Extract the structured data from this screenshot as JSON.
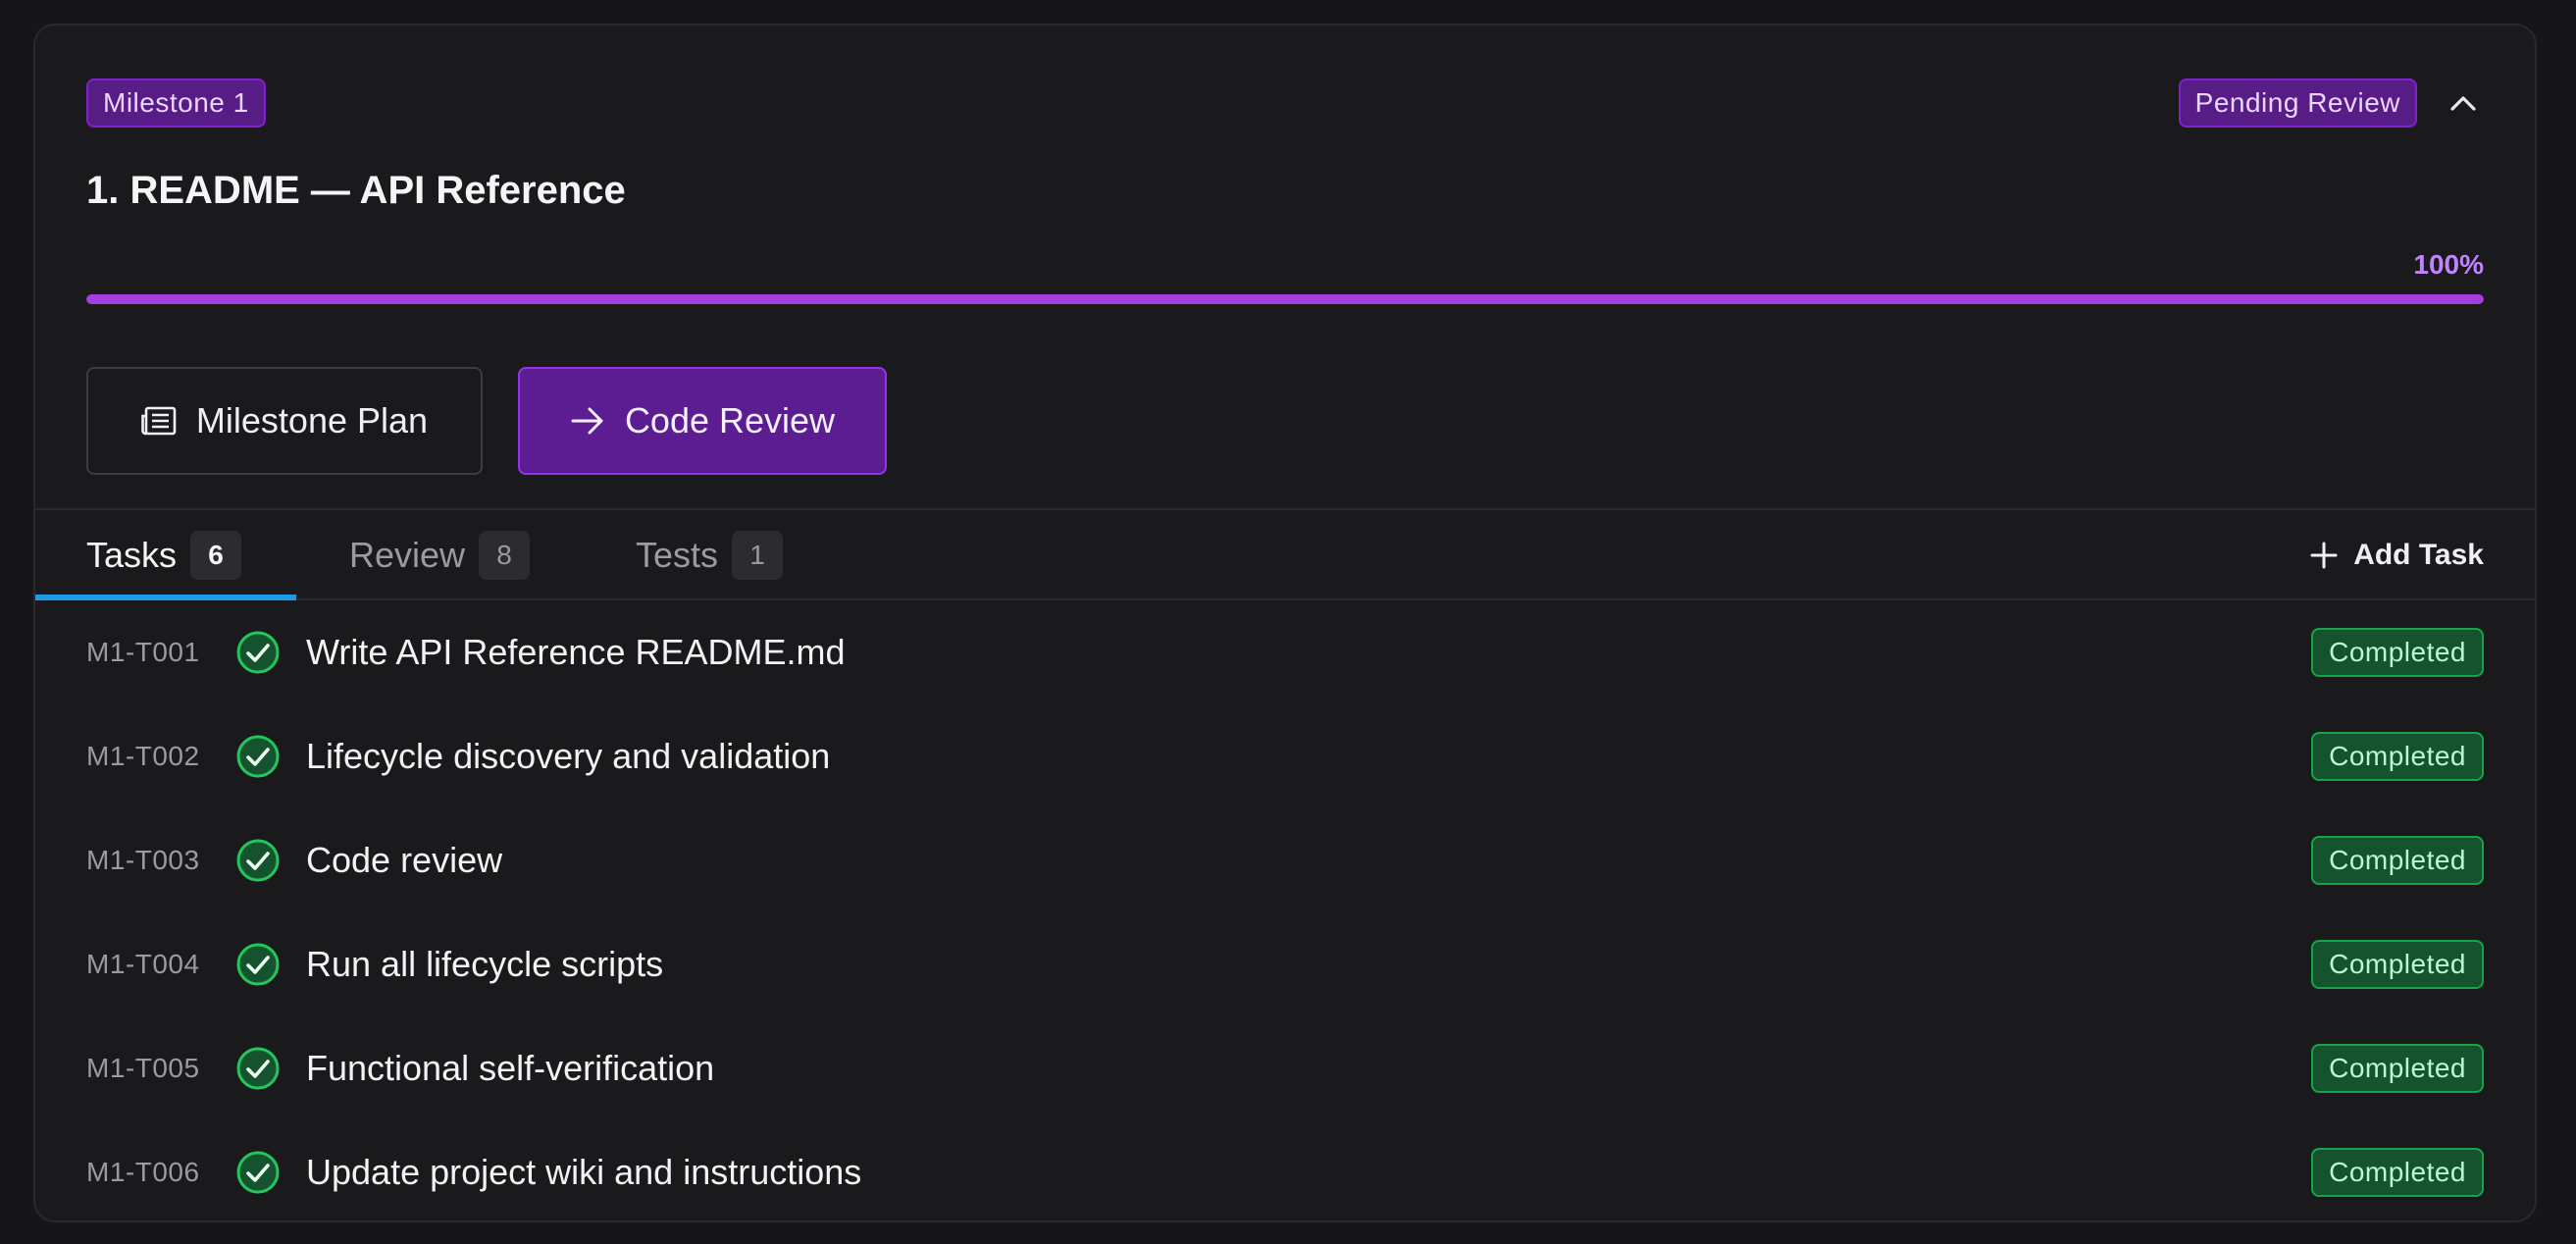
{
  "milestone": {
    "badge": "Milestone 1",
    "status": "Pending Review",
    "title": "1. README — API Reference",
    "progress_label": "100%",
    "progress_fraction": 1.0
  },
  "actions": {
    "plan_label": "Milestone Plan",
    "review_label": "Code Review"
  },
  "tabs": [
    {
      "label": "Tasks",
      "count": "6",
      "active": true
    },
    {
      "label": "Review",
      "count": "8",
      "active": false
    },
    {
      "label": "Tests",
      "count": "1",
      "active": false
    }
  ],
  "add_task_label": "Add Task",
  "tasks": [
    {
      "id": "M1-T001",
      "name": "Write API Reference README.md",
      "status": "Completed"
    },
    {
      "id": "M1-T002",
      "name": "Lifecycle discovery and validation",
      "status": "Completed"
    },
    {
      "id": "M1-T003",
      "name": "Code review",
      "status": "Completed"
    },
    {
      "id": "M1-T004",
      "name": "Run all lifecycle scripts",
      "status": "Completed"
    },
    {
      "id": "M1-T005",
      "name": "Functional self-verification",
      "status": "Completed"
    },
    {
      "id": "M1-T006",
      "name": "Update project wiki and instructions",
      "status": "Completed"
    }
  ],
  "icons": {
    "collapse": "chevron-up-icon",
    "plan": "document-list-icon",
    "review": "arrow-right-icon",
    "add": "plus-icon",
    "task_done": "check-circle-icon"
  },
  "colors": {
    "accent_purple": "#7e22ce",
    "progress": "#a43ee0",
    "tab_underline": "#1e9be6",
    "completed_bg": "#14532d",
    "completed_border": "#16a34a"
  }
}
